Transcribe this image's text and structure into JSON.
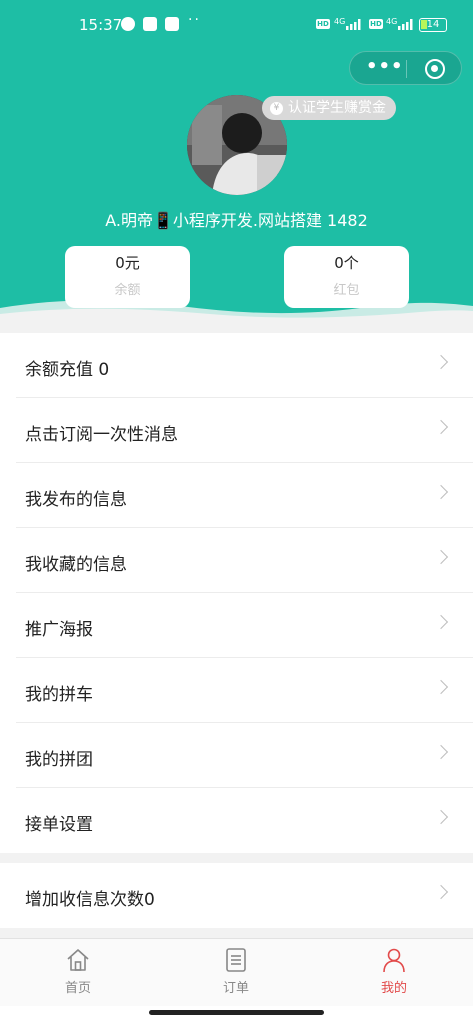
{
  "status_bar": {
    "time": "15:37",
    "network1": "4G",
    "network2": "4G",
    "battery": "14",
    "hd_label": "HD"
  },
  "capsule": {
    "more_icon": "more-dots-icon",
    "close_icon": "target-icon"
  },
  "profile": {
    "badge": "认证学生赚赏金",
    "username": "A.明帝📱小程序开发.网站搭建 1482"
  },
  "stats": {
    "balance": {
      "value": "0元",
      "label": "余额"
    },
    "redpacket": {
      "value": "0个",
      "label": "红包"
    }
  },
  "menu_group1": [
    {
      "label": "余额充值 0"
    },
    {
      "label": "点击订阅一次性消息"
    },
    {
      "label": "我发布的信息"
    },
    {
      "label": "我收藏的信息"
    },
    {
      "label": "推广海报"
    },
    {
      "label": "我的拼车"
    },
    {
      "label": "我的拼团"
    },
    {
      "label": "接单设置"
    }
  ],
  "menu_group2": [
    {
      "label": "增加收信息次数0"
    }
  ],
  "tabbar": {
    "home": "首页",
    "orders": "订单",
    "mine": "我的"
  },
  "colors": {
    "brand": "#1ebea5",
    "active_tab": "#e24b4b"
  }
}
